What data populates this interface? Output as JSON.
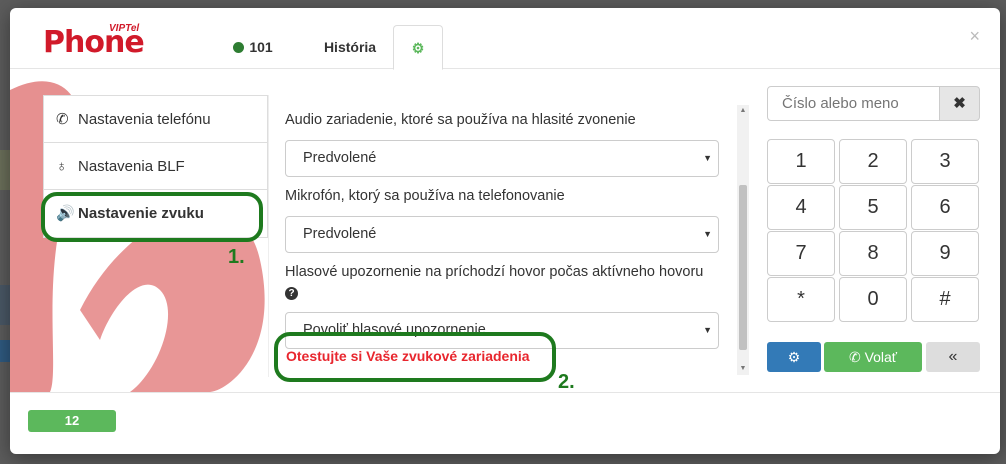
{
  "logo": {
    "text": "Phone",
    "superscript": "VIPTel"
  },
  "tabs": [
    {
      "label": "101",
      "status_color": "#2e7d32"
    },
    {
      "label": "História"
    },
    {
      "label": "",
      "icon": "gear-icon"
    }
  ],
  "sidebar": {
    "items": [
      {
        "label": "Nastavenia telefónu",
        "icon": "phone-icon"
      },
      {
        "label": "Nastavenia BLF",
        "icon": "lightbulb-icon"
      },
      {
        "label": "Nastavenie zvuku",
        "icon": "speaker-icon",
        "active": true
      }
    ]
  },
  "annotations": {
    "step1": "1.",
    "step2": "2.",
    "color": "#1e7a1e"
  },
  "settings": {
    "ring_device_label": "Audio zariadenie, ktoré sa používa na hlasité zvonenie",
    "ring_device_value": "Predvolené",
    "mic_label": "Mikrofón, ktorý sa používa na telefonovanie",
    "mic_value": "Predvolené",
    "voice_alert_label": "Hlasové upozornenie na príchodzí hovor počas aktívneho hovoru",
    "voice_alert_value": "Povoliť hlasové upozornenie",
    "test_link": "Otestujte si Vaše zvukové zariadenia"
  },
  "dialer": {
    "search_placeholder": "Číslo alebo meno",
    "keys": [
      "1",
      "2",
      "3",
      "4",
      "5",
      "6",
      "7",
      "8",
      "9",
      "*",
      "0",
      "#"
    ],
    "call_label": "Volať",
    "collapse_label": "«"
  },
  "footer": {
    "badge": "12"
  },
  "colors": {
    "brand": "#d11a2a",
    "link_red": "#e8262e",
    "primary": "#337ab7",
    "success": "#5cb85c"
  }
}
